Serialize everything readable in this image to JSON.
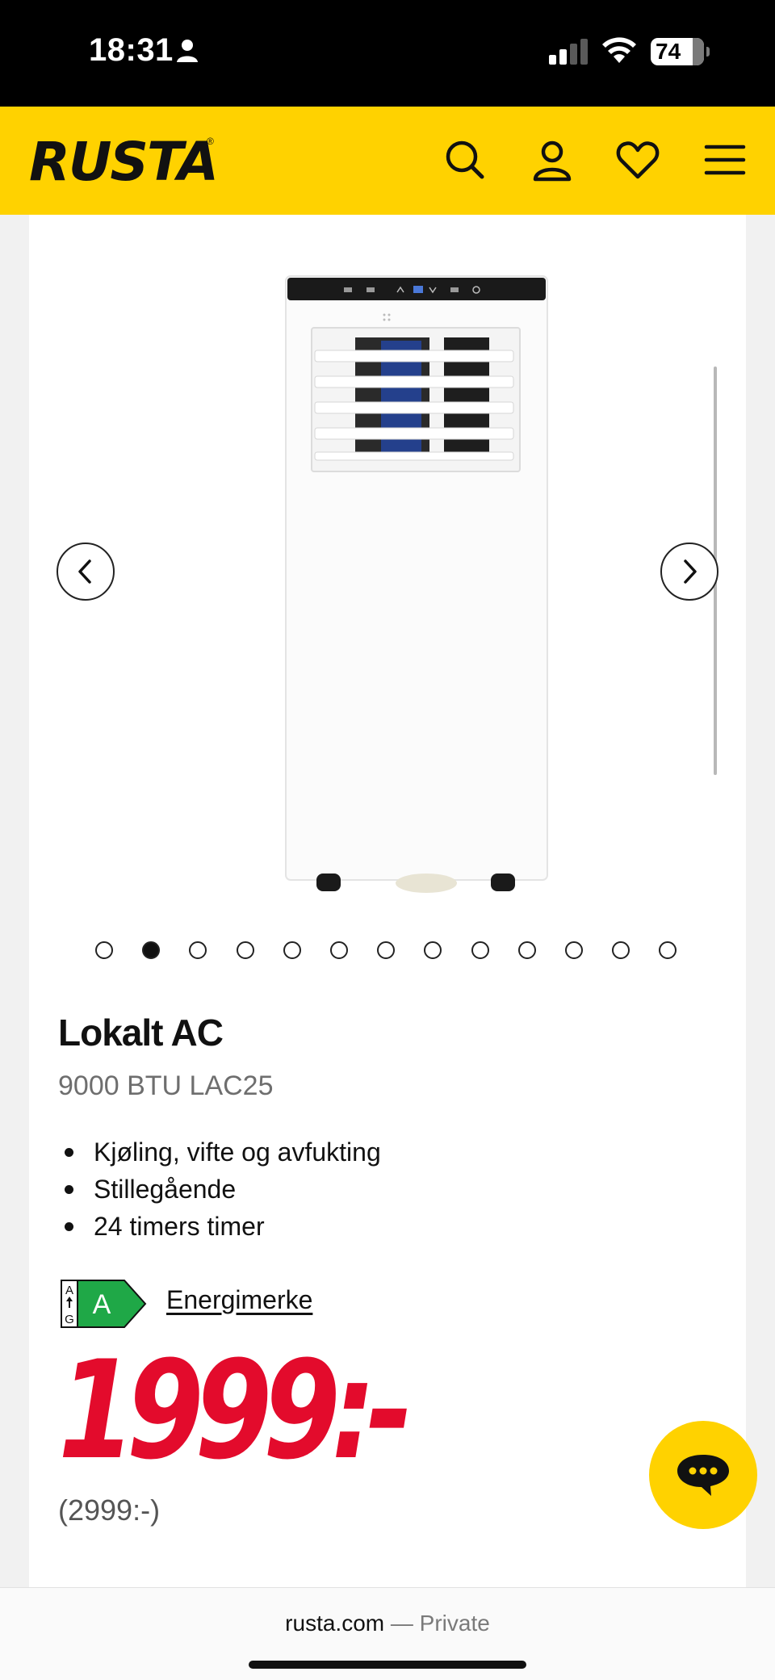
{
  "status_bar": {
    "time": "18:31",
    "battery": "74",
    "person_icon": "person-icon",
    "signal_icon": "cellular-signal-icon",
    "wifi_icon": "wifi-icon"
  },
  "header": {
    "logo": "RUSTA",
    "logo_mark": "®",
    "icons": [
      "search-icon",
      "user-icon",
      "heart-icon",
      "menu-icon"
    ],
    "background_color": "#ffd200"
  },
  "carousel": {
    "image_description_icon": "product-image",
    "dot_count": 13,
    "active_dot_index": 1
  },
  "product": {
    "title": "Lokalt AC",
    "subtitle": "9000 BTU LAC25",
    "features": [
      "Kjøling, vifte og avfukting",
      "Stillegående",
      "24 timers timer"
    ],
    "energy_class": "A",
    "energy_scale_top": "A",
    "energy_scale_bottom": "G",
    "energy_link": "Energimerke",
    "price": "1999:-",
    "old_price": "(2999:-)",
    "price_color": "#e30b2c"
  },
  "browser": {
    "domain": "rusta.com",
    "separator": "—",
    "mode": "Private"
  }
}
